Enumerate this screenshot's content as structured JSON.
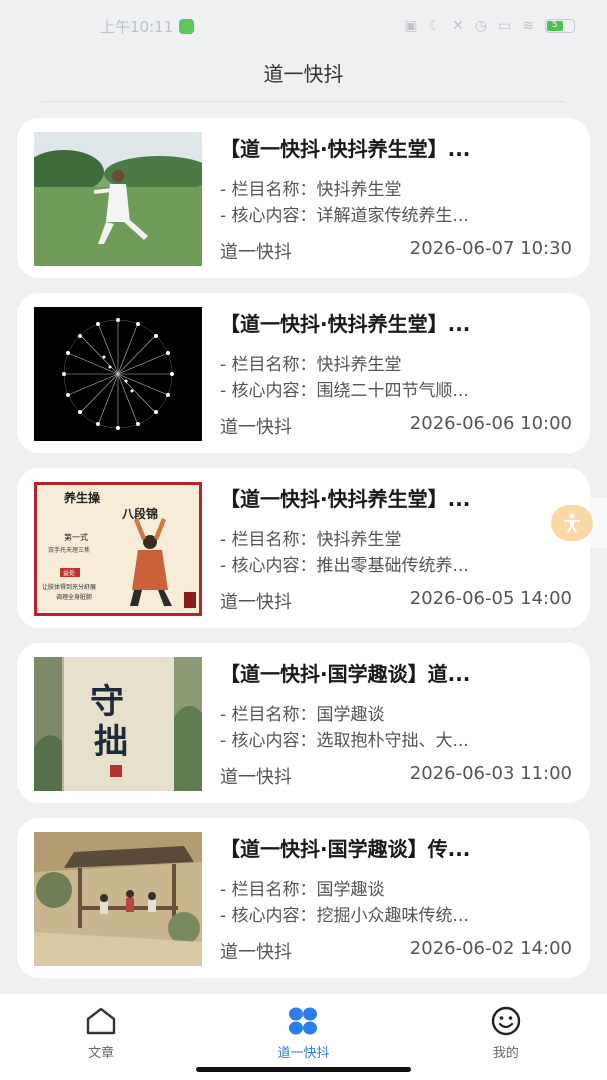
{
  "status_bar": {
    "time": "上午10:11",
    "battery": "5"
  },
  "header": {
    "title": "道一快抖"
  },
  "feed": [
    {
      "title": "【道一快抖·快抖养生堂】...",
      "column_label": "- 栏目名称：",
      "column": "快抖养生堂",
      "content_label": "- 核心内容：",
      "content": "详解道家传统养生...",
      "source": "道一快抖",
      "date": "2026-06-07 10:30"
    },
    {
      "title": "【道一快抖·快抖养生堂】...",
      "column_label": "- 栏目名称：",
      "column": "快抖养生堂",
      "content_label": "- 核心内容：",
      "content": "围绕二十四节气顺...",
      "source": "道一快抖",
      "date": "2026-06-06 10:00"
    },
    {
      "title": "【道一快抖·快抖养生堂】...",
      "column_label": "- 栏目名称：",
      "column": "快抖养生堂",
      "content_label": "- 核心内容：",
      "content": "推出零基础传统养...",
      "source": "道一快抖",
      "date": "2026-06-05 14:00"
    },
    {
      "title": "【道一快抖·国学趣谈】道...",
      "column_label": "- 栏目名称：",
      "column": "国学趣谈",
      "content_label": "- 核心内容：",
      "content": "选取抱朴守拙、大...",
      "source": "道一快抖",
      "date": "2026-06-03 11:00"
    },
    {
      "title": "【道一快抖·国学趣谈】传...",
      "column_label": "- 栏目名称：",
      "column": "国学趣谈",
      "content_label": "- 核心内容：",
      "content": "挖掘小众趣味传统...",
      "source": "道一快抖",
      "date": "2026-06-02 14:00"
    }
  ],
  "thumbnails": {
    "poster_title_1": "养生操",
    "poster_title_2": "八段锦",
    "poster_sub": "第一式",
    "poster_line": "双手托天理三焦",
    "poster_tag": "益处",
    "poster_note_1": "让肢体得到充分舒展",
    "poster_note_2": "调理全身脏腑",
    "calligraphy_1": "守",
    "calligraphy_2": "拙"
  },
  "tabbar": {
    "tabs": [
      {
        "label": "文章",
        "icon": "home-icon",
        "active": false
      },
      {
        "label": "道一快抖",
        "icon": "grid-icon",
        "active": true
      },
      {
        "label": "我的",
        "icon": "smiley-icon",
        "active": false
      }
    ]
  },
  "colors": {
    "accent": "#2b7de9",
    "background": "#eef0f2",
    "card": "#ffffff",
    "float_button": "#fbd9a6"
  }
}
